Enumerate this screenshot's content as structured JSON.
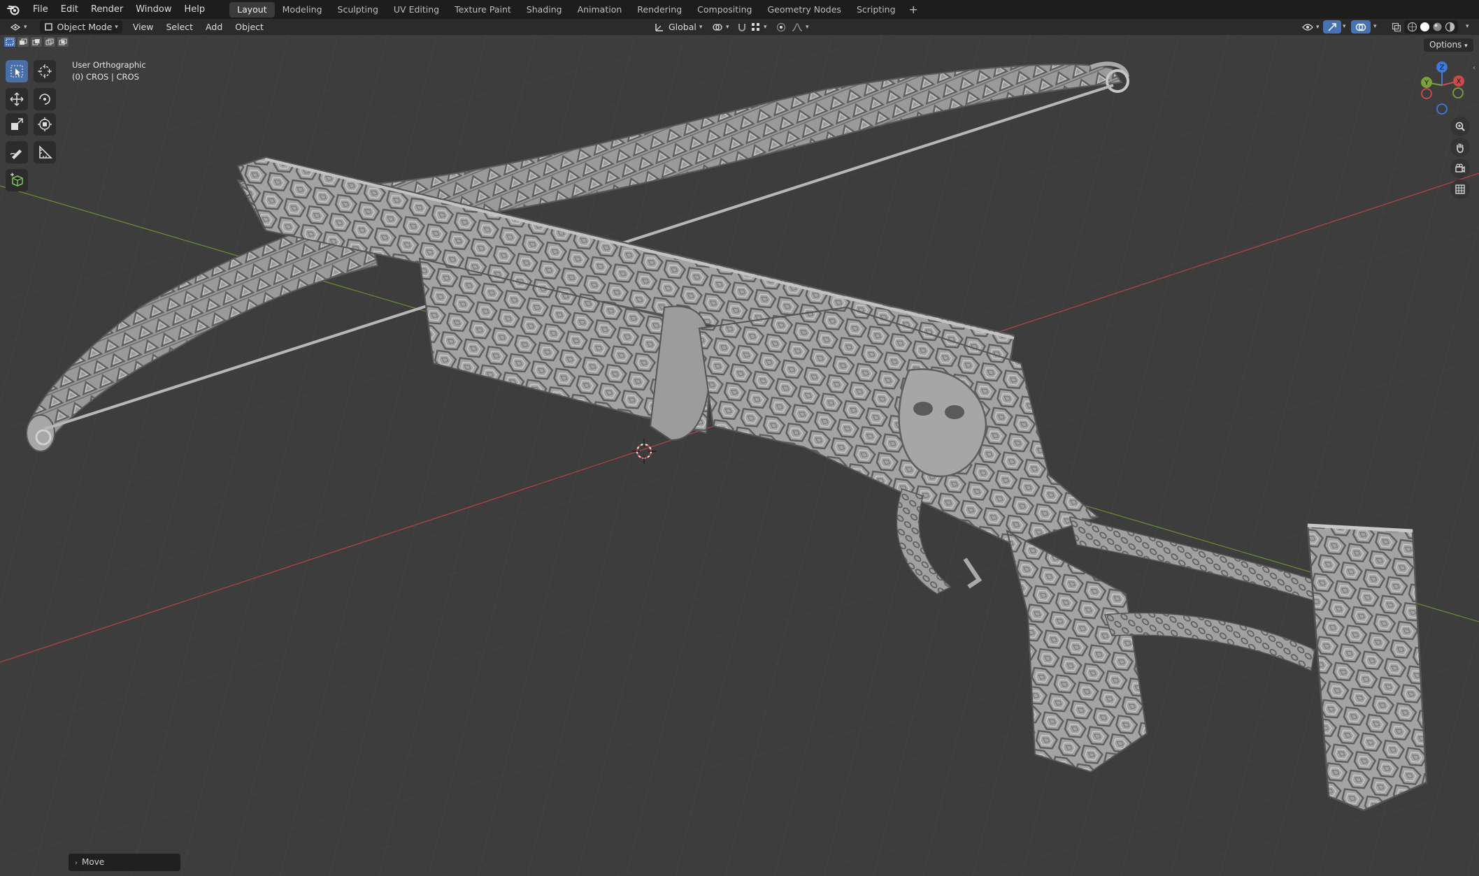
{
  "topbar": {
    "menus": [
      "File",
      "Edit",
      "Render",
      "Window",
      "Help"
    ],
    "workspaces": [
      "Layout",
      "Modeling",
      "Sculpting",
      "UV Editing",
      "Texture Paint",
      "Shading",
      "Animation",
      "Rendering",
      "Compositing",
      "Geometry Nodes",
      "Scripting"
    ],
    "active_workspace": "Layout",
    "add_label": "+"
  },
  "header": {
    "mode": "Object Mode",
    "menus": [
      "View",
      "Select",
      "Add",
      "Object"
    ],
    "orientation": "Global"
  },
  "viewport": {
    "view_name": "User Orthographic",
    "object_info": "(0) CROS | CROS",
    "options_label": "Options",
    "axis_labels": {
      "z": "Z",
      "x": "X",
      "y": "Y"
    }
  },
  "last_operator": {
    "label": "Move"
  },
  "colors": {
    "accent": "#4772b3",
    "x_axis": "#c94b4b",
    "y_axis": "#7aa13c",
    "z_axis": "#3f7bd6",
    "viewport_bg": "#3d3d3d"
  }
}
